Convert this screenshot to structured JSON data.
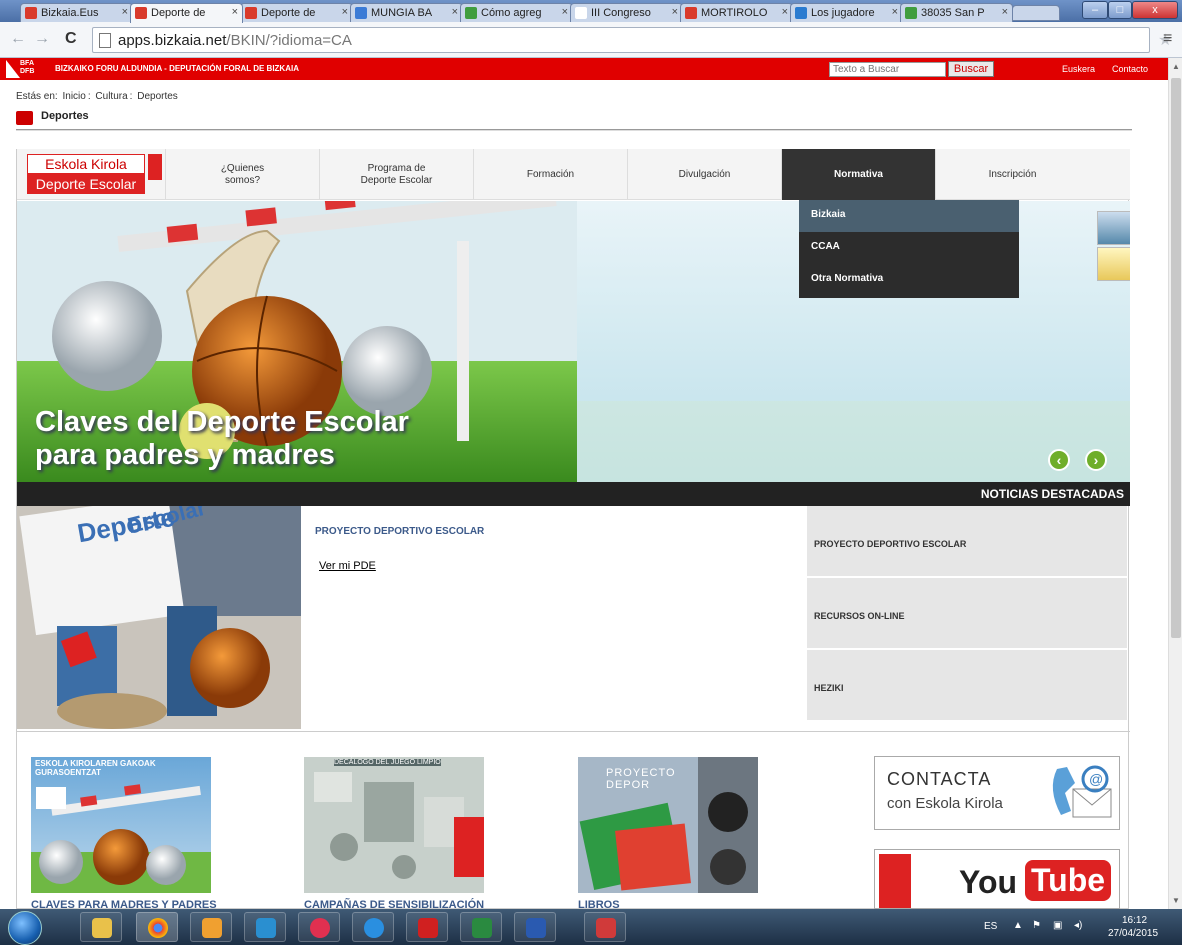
{
  "browser": {
    "tabs": [
      {
        "label": "Bizkaia.Eus",
        "active": false,
        "color": "#d93a2b"
      },
      {
        "label": "Deporte de",
        "active": true,
        "color": "#d93a2b"
      },
      {
        "label": "Deporte de",
        "active": false,
        "color": "#d93a2b"
      },
      {
        "label": "MUNGIA BA",
        "active": false,
        "color": "#3b7bd6"
      },
      {
        "label": "Cómo agreg",
        "active": false,
        "color": "#3f9d3f"
      },
      {
        "label": "III Congreso",
        "active": false,
        "color": "#ffffff"
      },
      {
        "label": "MORTIROLO",
        "active": false,
        "color": "#d93a2b"
      },
      {
        "label": "Los jugadore",
        "active": false,
        "color": "#2a7bd0"
      },
      {
        "label": "38035 San P",
        "active": false,
        "color": "#3f9d3f"
      }
    ],
    "tab_close": "×",
    "url_host": "apps.bizkaia.net",
    "url_path": "/BKIN/?idioma=CA"
  },
  "header": {
    "logo_top": "BFA",
    "logo_bottom": "DFB",
    "org": "BIZKAIKO FORU ALDUNDIA - DEPUTACIÓN FORAL DE BIZKAIA",
    "search_placeholder": "Texto a Buscar",
    "search_button": "Buscar",
    "lang_link": "Euskera",
    "contact_link": "Contacto"
  },
  "breadcrumb": {
    "prefix": "Estás en:",
    "items": [
      "Inicio",
      "Cultura",
      "Deportes"
    ],
    "separator": ":"
  },
  "section_title": "Deportes",
  "site": {
    "brand_line1": "Eskola Kirola",
    "brand_line2": "Deporte Escolar",
    "nav": [
      {
        "label": "¿Quienes somos?",
        "active": false
      },
      {
        "label": "Programa de Deporte Escolar",
        "active": false
      },
      {
        "label": "Formación",
        "active": false
      },
      {
        "label": "Divulgación",
        "active": false
      },
      {
        "label": "Normativa",
        "active": true
      },
      {
        "label": "Inscripción",
        "active": false
      }
    ],
    "dropdown": [
      "Bizkaia",
      "CCAA",
      "Otra Normativa"
    ],
    "hero_line1": "Claves del Deporte Escolar",
    "hero_line2": "para padres y madres",
    "news_header": "NOTICIAS DESTACADAS",
    "news_image_text1": "Deporte",
    "news_image_text2": "Escolar",
    "news_title": "PROYECTO DEPORTIVO ESCOLAR",
    "news_link": "Ver mi PDE",
    "news_list": [
      "PROYECTO DEPORTIVO ESCOLAR",
      "RECURSOS ON-LINE",
      "HEZIKI"
    ],
    "thumbs": [
      {
        "caption": "CLAVES PARA MADRES Y PADRES",
        "overlay": "ESKOLA KIROLAREN GAKOAK GURASOENTZAT"
      },
      {
        "caption": "CAMPAÑAS DE SENSIBILIZACIÓN",
        "overlay": "DECÁLOGO DEL JUEGO LIMPIO"
      },
      {
        "caption": "LIBROS",
        "overlay": "PROYECTO DEPOR"
      }
    ],
    "contacta_line1": "CONTACTA",
    "contacta_line2": "con Eskola Kirola",
    "youtube_you": "You",
    "youtube_tube": "Tube"
  },
  "taskbar": {
    "lang": "ES",
    "time": "16:12",
    "date": "27/04/2015"
  },
  "colors": {
    "brand_red": "#e00000",
    "nav_active": "#333333",
    "link_blue": "#3c5a8a"
  }
}
